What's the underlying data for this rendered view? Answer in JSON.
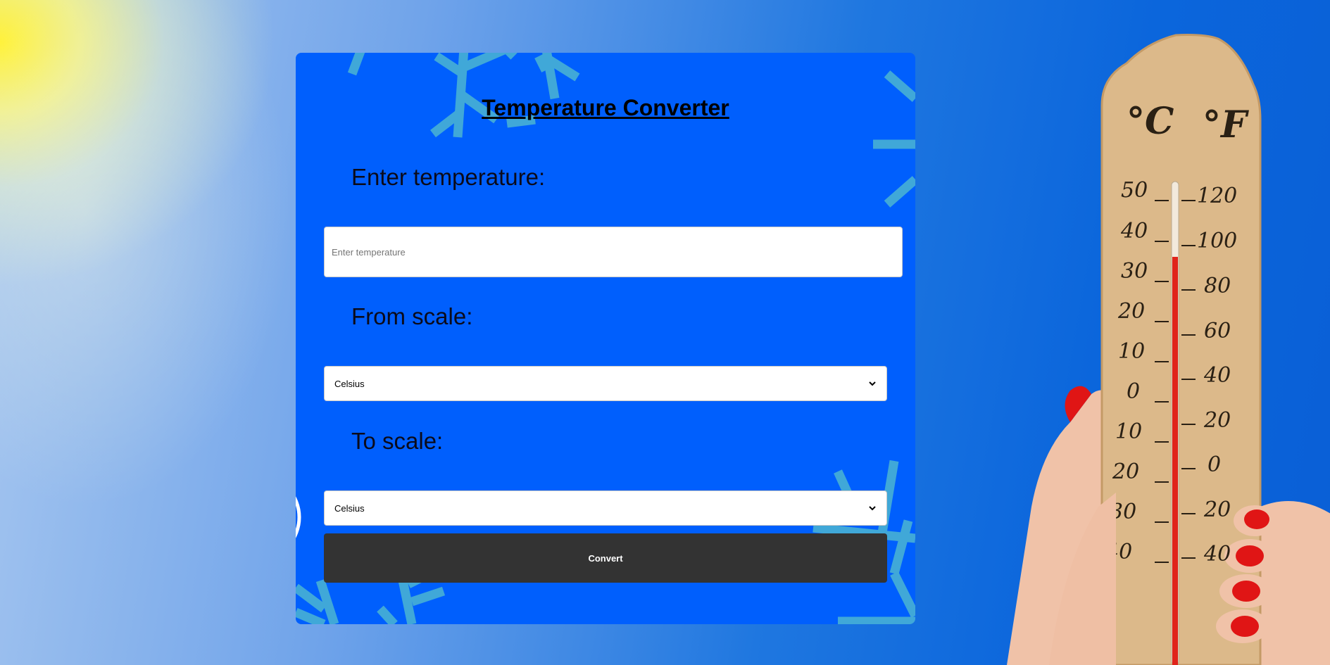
{
  "card": {
    "title": "Temperature Converter",
    "temp_label": "Enter temperature:",
    "temp_placeholder": "Enter temperature",
    "temp_value": "",
    "from_label": "From scale:",
    "from_selected": "Celsius",
    "to_label": "To scale:",
    "to_selected": "Celsius",
    "convert_label": "Convert",
    "bg_color": "#005ffd",
    "button_color": "#333333"
  },
  "thermometer": {
    "unit_left": "°C",
    "unit_right": "°F",
    "celsius_ticks": [
      "50",
      "40",
      "30",
      "20",
      "10",
      "0",
      "10",
      "20",
      "30",
      "40"
    ],
    "fahrenheit_ticks": [
      "120",
      "100",
      "80",
      "60",
      "40",
      "20",
      "0",
      "20",
      "40"
    ]
  },
  "icons": [
    "snowflake-icon",
    "chevron-down-icon"
  ]
}
